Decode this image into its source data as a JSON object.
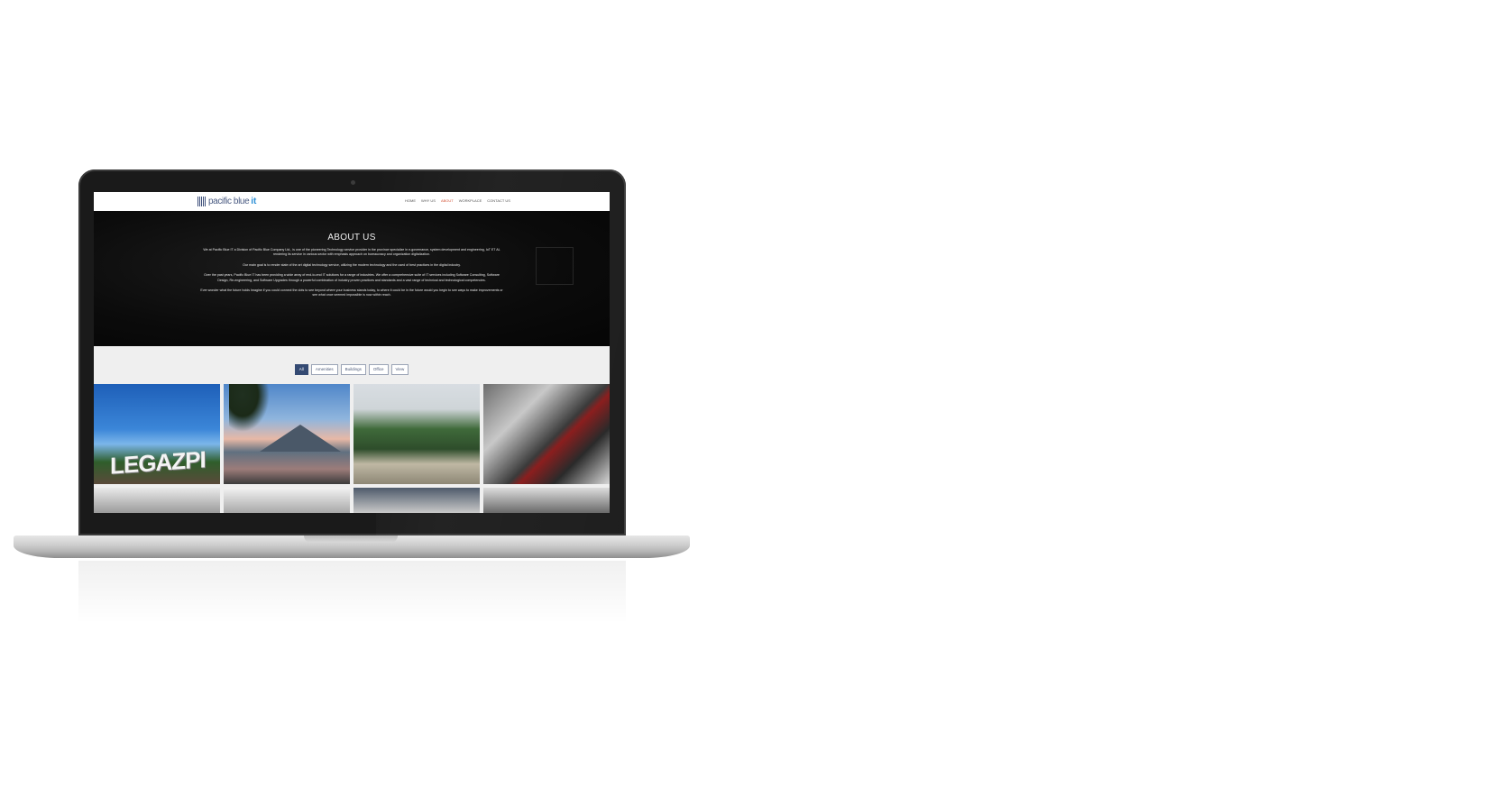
{
  "site": {
    "logo_text": "pacific blue",
    "logo_suffix": "it",
    "nav": [
      "HOME",
      "WHY US",
      "ABOUT",
      "WORKPLACE",
      "CONTACT US"
    ],
    "active_nav": "ABOUT"
  },
  "about": {
    "title": "ABOUT US",
    "paragraphs": [
      "We at Pacific Blue IT a Division of Pacific Blue Company Ltd., is one of the pioneering Technology service provider in the province specialize in e-governance, system development and engineering, IoT ET AL rendering its service in various sector with emphasis approach on bureaucracy and organization digitalization.",
      "Our main goal is to render state of the art digital technology service, utilizing the modern technology and the used of best practices in the digital industry.",
      "Over the past years, Pacific Blue IT has been providing a wide array of end-to-end IT solutions for a range of industries. We offer a comprehensive suite of IT services including Software Consulting, Software Design, Re-engineering, and Software Upgrades through a powerful combination of industry proven practices and standards and a vast range of technical and technological competencies.",
      "Ever wonder what the future holds Imagine if you could connect the dots to see beyond where your business stands today, to where it could be in the future would you begin to see ways to make improvements or see what once seemed impossible is now within reach."
    ]
  },
  "gallery": {
    "filters": [
      "All",
      "Amenities",
      "Buildings",
      "Office",
      "View"
    ],
    "active_filter": "All",
    "tile1_text": "LEGAZPI"
  },
  "colors": {
    "accent": "#344a73",
    "active_nav": "#d4563b",
    "logo_blue": "#2c8fd6"
  }
}
